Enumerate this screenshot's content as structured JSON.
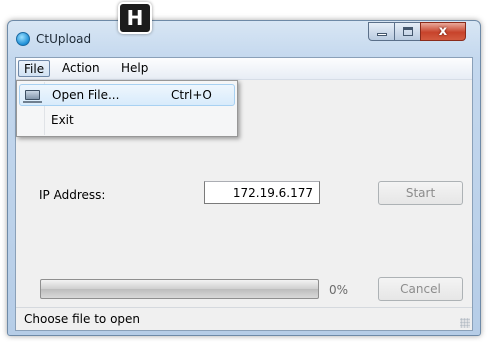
{
  "badge": {
    "label": "H"
  },
  "window": {
    "title": "CtUpload",
    "controls": {
      "minimize": "minimize",
      "maximize": "maximize",
      "close": "x"
    }
  },
  "menu": {
    "items": [
      "File",
      "Action",
      "Help"
    ],
    "file_dropdown": [
      {
        "label": "Open File...",
        "shortcut": "Ctrl+O",
        "icon": "computer-icon"
      },
      {
        "label": "Exit",
        "shortcut": ""
      }
    ]
  },
  "form": {
    "ip_label": "IP Address:",
    "ip_value": "172.19.6.177",
    "start_label": "Start",
    "cancel_label": "Cancel"
  },
  "progress": {
    "value": 0,
    "text": "0%"
  },
  "status": {
    "text": "Choose file to open"
  },
  "colors": {
    "close_button": "#c7432b",
    "title_bar": "#c4d8ee",
    "client_bg": "#f0f0f0"
  }
}
